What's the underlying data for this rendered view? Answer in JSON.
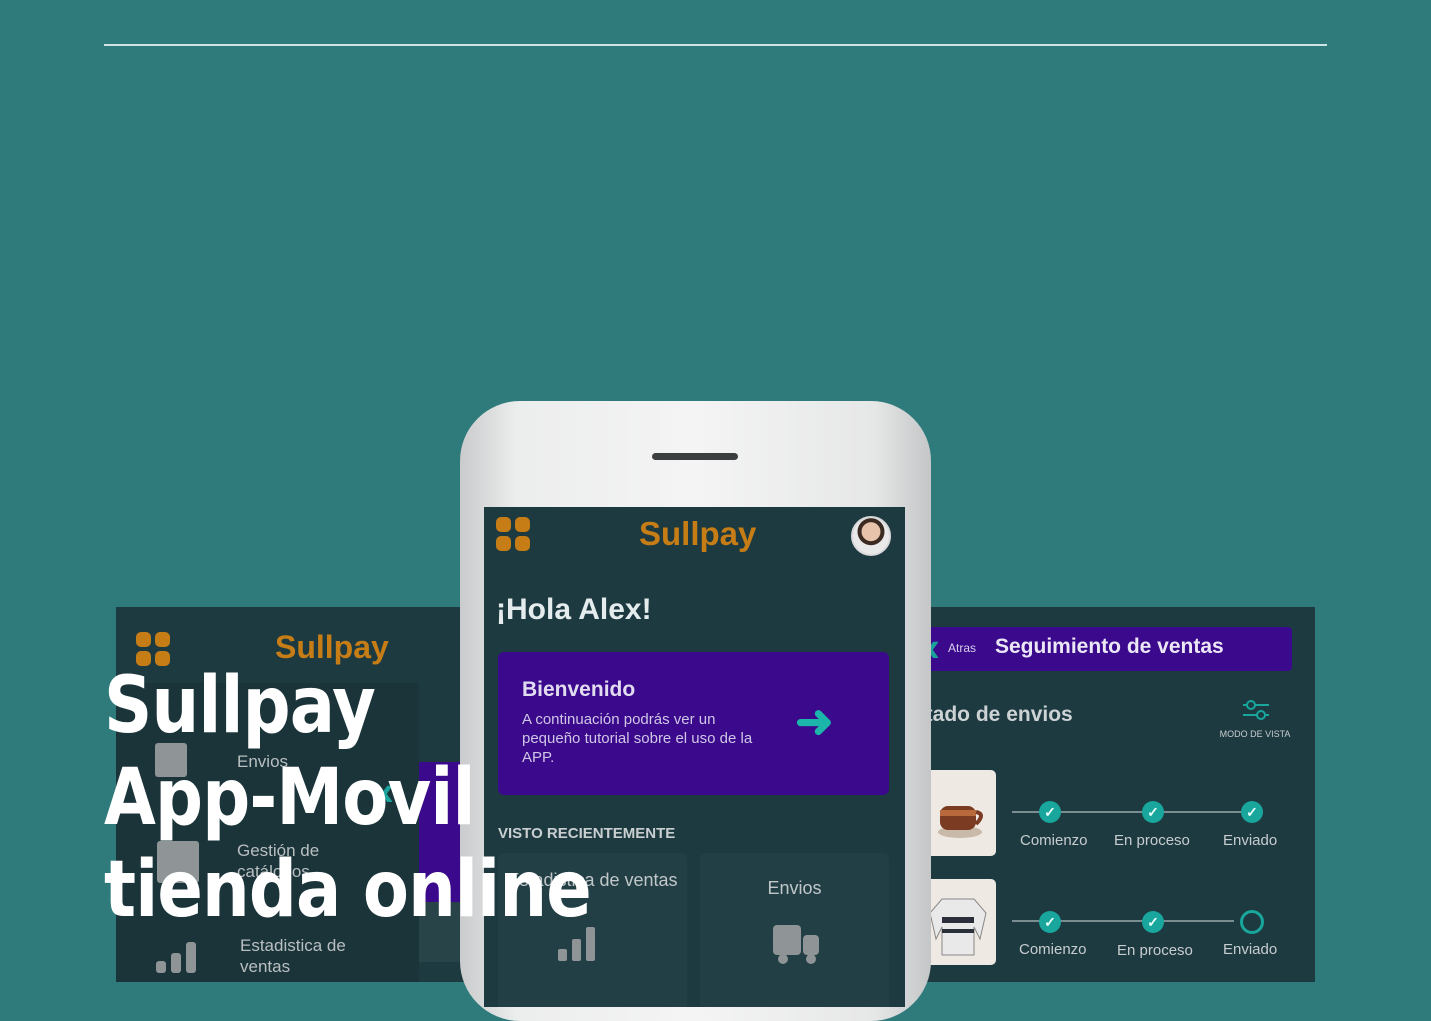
{
  "brand": {
    "name": "Sullpay",
    "color": "#c77d16",
    "icon": "apps-grid-icon"
  },
  "colors": {
    "background": "#2f7b7c",
    "screen": "#1d3a40",
    "accent_purple": "#3b0a8c",
    "accent_teal": "#18a69d"
  },
  "headline": {
    "line1": "Sullpay",
    "line2": "App-Movil",
    "line3": "tienda online"
  },
  "left_screen": {
    "menu_items": [
      {
        "label": "Envios",
        "icon": "truck-icon"
      },
      {
        "label": "Gestión de catálogos",
        "icon": "catalog-icon"
      },
      {
        "label": "Estadistica de ventas",
        "icon": "bar-chart-icon"
      }
    ]
  },
  "phone": {
    "greeting": "¡Hola Alex!",
    "welcome_card": {
      "title": "Bienvenido",
      "text": "A continuación podrás ver un pequeño tutorial sobre el uso de la APP.",
      "icon": "arrow-right-icon"
    },
    "recent_heading": "VISTO RECIENTEMENTE",
    "recent_cards": [
      {
        "label": "Estadistica de ventas",
        "icon": "bar-chart-icon"
      },
      {
        "label": "Envios",
        "icon": "truck-icon"
      }
    ]
  },
  "right_screen": {
    "back_label": "Atras",
    "title": "Seguimiento de ventas",
    "section_title": "Estado de envios",
    "view_mode_label": "MODO DE VISTA",
    "shipments": [
      {
        "product": "mug",
        "steps": [
          {
            "label": "Comienzo",
            "done": true
          },
          {
            "label": "En proceso",
            "done": true
          },
          {
            "label": "Enviado",
            "done": true
          }
        ]
      },
      {
        "product": "sweater",
        "steps": [
          {
            "label": "Comienzo",
            "done": true
          },
          {
            "label": "En proceso",
            "done": true
          },
          {
            "label": "Enviado",
            "done": false
          }
        ]
      }
    ]
  }
}
